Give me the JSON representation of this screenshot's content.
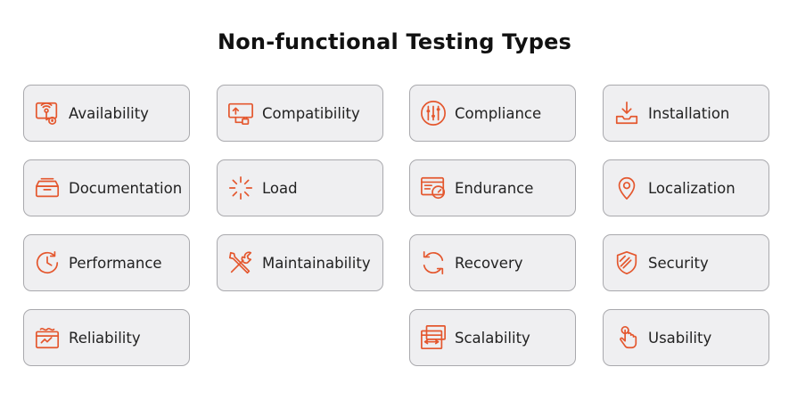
{
  "title": "Non-functional Testing Types",
  "accent_color": "#e4572e",
  "card_background": "#efeff1",
  "cards": [
    {
      "label": "Availability",
      "icon": "availability-icon"
    },
    {
      "label": "Compatibility",
      "icon": "compatibility-icon"
    },
    {
      "label": "Compliance",
      "icon": "sliders-icon"
    },
    {
      "label": "Installation",
      "icon": "download-tray-icon"
    },
    {
      "label": "Documentation",
      "icon": "archive-box-icon"
    },
    {
      "label": "Load",
      "icon": "loading-spinner-icon"
    },
    {
      "label": "Endurance",
      "icon": "dashboard-gauge-icon"
    },
    {
      "label": "Localization",
      "icon": "map-pin-icon"
    },
    {
      "label": "Performance",
      "icon": "clock-arrow-icon"
    },
    {
      "label": "Maintainability",
      "icon": "wrench-screwdriver-icon"
    },
    {
      "label": "Recovery",
      "icon": "refresh-icon"
    },
    {
      "label": "Security",
      "icon": "shield-icon"
    },
    {
      "label": "Reliability",
      "icon": "reliability-icon"
    },
    {
      "label": "Scalability",
      "icon": "stacked-windows-icon"
    },
    {
      "label": "Usability",
      "icon": "tap-hand-icon"
    }
  ]
}
